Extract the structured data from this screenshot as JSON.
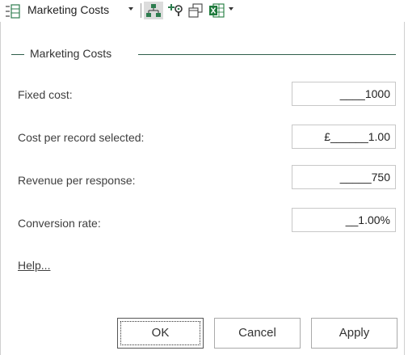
{
  "toolbar": {
    "title": "Marketing Costs",
    "icons": [
      "panel-list-icon",
      "tree-hierarchy-icon",
      "add-query-icon",
      "copy-window-icon",
      "excel-export-icon"
    ]
  },
  "dialog": {
    "section_title": "Marketing Costs",
    "fields": [
      {
        "label": "Fixed cost:",
        "value": "____1000"
      },
      {
        "label": "Cost per record selected:",
        "value": "£______1.00"
      },
      {
        "label": "Revenue per response:",
        "value": "_____750"
      },
      {
        "label": "Conversion rate:",
        "value": "__1.00%"
      }
    ],
    "help_link": "Help...",
    "buttons": {
      "ok": "OK",
      "cancel": "Cancel",
      "apply": "Apply"
    }
  },
  "colors": {
    "section_rule": "#2f5e4a",
    "excel_green": "#1e7a3c",
    "toolbar_green": "#3a8a5a"
  }
}
